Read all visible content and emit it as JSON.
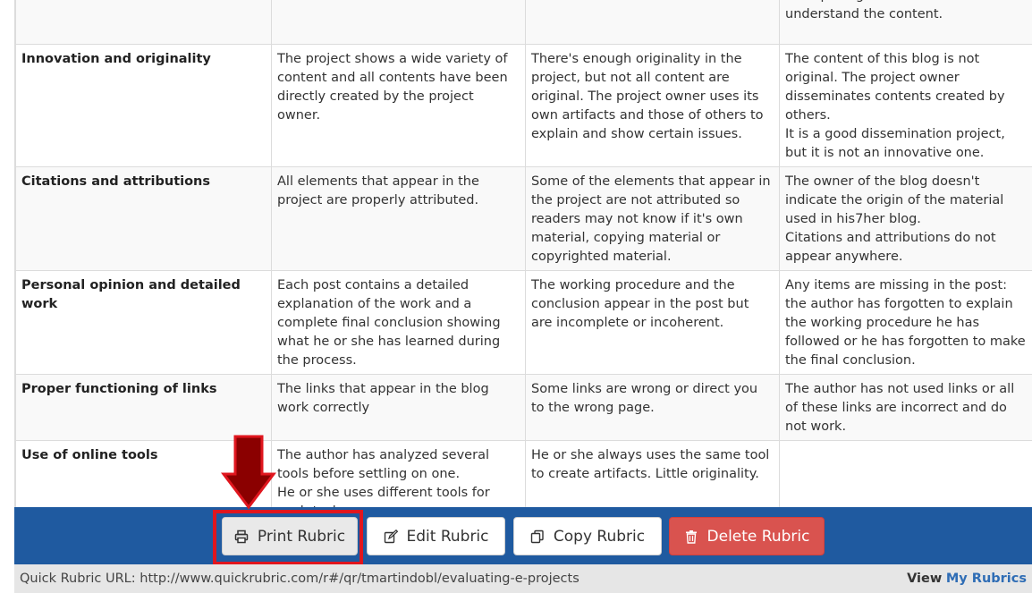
{
  "rubric": {
    "rows": [
      {
        "criterion": "",
        "cells": [
          "",
          "",
          "and spelling errors make difficult to understand the content."
        ]
      },
      {
        "criterion": "Innovation and originality",
        "cells": [
          "The project shows a wide variety of content and all contents have been directly created by the project owner.",
          "There's enough originality in the project, but not all content are original. The project owner uses its own artifacts and those of others to explain and show certain issues.",
          "The content of this blog is not original. The project owner disseminates contents created by others.\nIt is a good dissemination project, but it is not an innovative one."
        ]
      },
      {
        "criterion": "Citations and attributions",
        "cells": [
          "All elements that appear in the project are properly attributed.",
          "Some of the elements that appear in the project are not attributed so readers may not know if it's own material, copying material or copyrighted material.",
          "The owner of the blog doesn't indicate the origin of the material used in his7her blog.\nCitations and attributions do not appear anywhere."
        ]
      },
      {
        "criterion": "Personal opinion and detailed work",
        "cells": [
          "Each post contains a detailed explanation of the work and a complete final conclusion showing what he or she has learned during the process.",
          "The working procedure and the conclusion appear in the post but are incomplete or incoherent.",
          "Any items are missing in the post: the author has forgotten to explain the working procedure he has followed or he has forgotten to make the final conclusion."
        ]
      },
      {
        "criterion": "Proper functioning of links",
        "cells": [
          "The links that appear in the blog work correctly",
          "Some links are wrong or direct you to the wrong page.",
          "The author has not used links or all of these links are incorrect and do not work."
        ]
      },
      {
        "criterion": "Use of online tools",
        "cells": [
          "The author has analyzed several tools before settling on one.\nHe or she uses different tools for each task.",
          "He or she always uses the same tool to create artifacts. Little originality.",
          ""
        ]
      }
    ]
  },
  "toolbar": {
    "print_label": "Print Rubric",
    "edit_label": "Edit Rubric",
    "copy_label": "Copy Rubric",
    "delete_label": "Delete Rubric",
    "print_icon": "printer-icon",
    "edit_icon": "edit-icon",
    "copy_icon": "copy-icon",
    "delete_icon": "trash-icon",
    "bar_color": "#1f5aa0",
    "delete_color": "#d9534f"
  },
  "annotation": {
    "arrow_color": "#8b0000",
    "box_color": "#e0161e"
  },
  "footer": {
    "url_label": "Quick Rubric URL: http://www.quickrubric.com/r#/qr/tmartindobl/evaluating-e-projects",
    "view_label": "View",
    "my_rubrics_label": "My Rubrics"
  }
}
